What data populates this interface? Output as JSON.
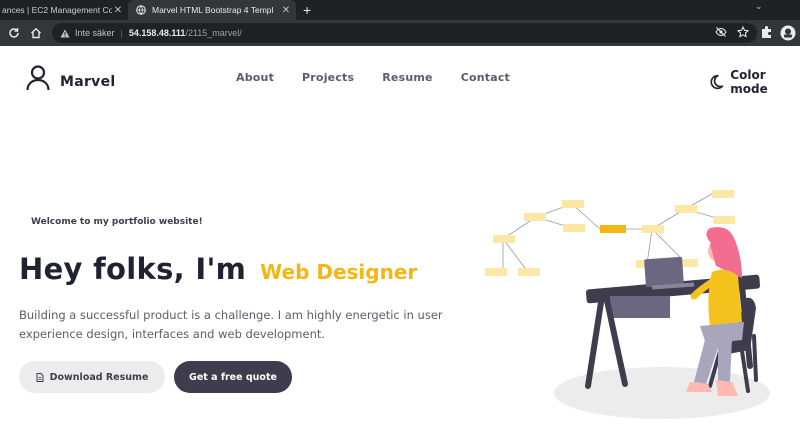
{
  "browser": {
    "tabs": [
      {
        "title": "ances | EC2 Management Co"
      },
      {
        "title": "Marvel HTML Bootstrap 4 Templ"
      }
    ],
    "address": {
      "security_label": "Inte säker",
      "host": "54.158.48.111",
      "path": "/2115_marvel/"
    }
  },
  "site": {
    "brand": "Marvel",
    "nav": [
      "About",
      "Projects",
      "Resume",
      "Contact"
    ],
    "color_mode_label": "Color mode"
  },
  "hero": {
    "welcome": "Welcome to my portfolio website!",
    "headline": "Hey folks, I'm",
    "role": "Web Designer",
    "lead": "Building a successful product is a challenge. I am highly energetic in user experience design, interfaces and web development.",
    "download_label": "Download Resume",
    "quote_label": "Get a free quote"
  },
  "colors": {
    "accent": "#f3b715",
    "dark_button": "#3f3c4e",
    "text_dark": "#1f2330",
    "text_muted": "#5a5e6a"
  },
  "icons": {
    "brand": "user-outline-icon",
    "color_mode": "moon-icon",
    "download": "document-icon"
  }
}
